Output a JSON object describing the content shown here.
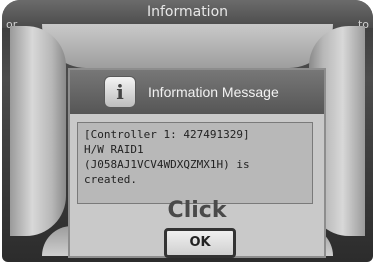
{
  "window": {
    "title": "Information",
    "background_fragment_left": "or",
    "background_fragment_right": "to"
  },
  "dialog": {
    "title": "Information Message",
    "icon": "info-icon",
    "message_lines": [
      "[Controller 1: 427491329]",
      "H/W RAID1",
      "(J058AJ1VCV4WDXQZMX1H) is",
      "created."
    ],
    "annotation": "Click",
    "ok_label": "OK"
  }
}
